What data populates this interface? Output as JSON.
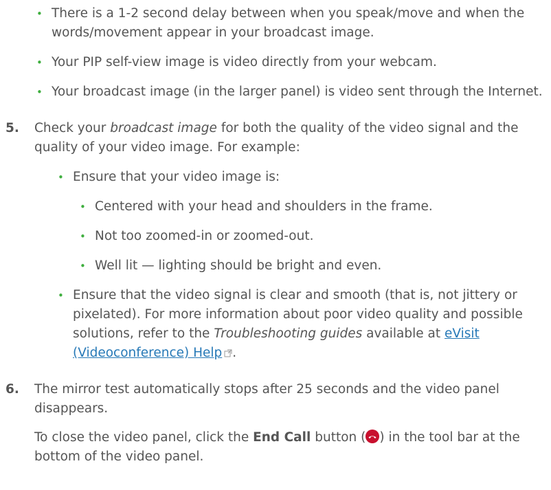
{
  "top_bullets": [
    "There is a 1-2 second delay between when you speak/move and when the words/movement appear in your broadcast image.",
    "Your PIP self-view image is video directly from your webcam.",
    "Your broadcast image (in the larger panel) is video sent through the Internet."
  ],
  "step5": {
    "number": "5.",
    "text_before": "Check your ",
    "text_emphasis": "broadcast image",
    "text_after": " for both the quality of the video signal and the quality of your video image. For example:",
    "bullet1": "Ensure that your video image is:",
    "sub_bullets": [
      "Centered with your head and shoulders in the frame.",
      "Not too zoomed-in or zoomed-out.",
      "Well lit — lighting should be bright and even."
    ],
    "bullet2_before": "Ensure that the video signal is clear and smooth (that is, not jittery or pixelated). For more information about poor video quality and possible solutions, refer to the ",
    "bullet2_emphasis": "Troubleshooting guides",
    "bullet2_middle": " available at ",
    "link_text": "eVisit (Videoconference) Help",
    "bullet2_end": "."
  },
  "step6": {
    "number": "6.",
    "text": "The mirror test automatically stops after 25 seconds and the video panel disappears.",
    "close_before": "To close the video panel, click the ",
    "close_bold": "End Call",
    "close_middle": " button (",
    "close_after": ") in the tool bar at the bottom of the video panel."
  },
  "colors": {
    "text": "#555555",
    "bullet": "#3eae3e",
    "link": "#2779b7",
    "end_call": "#c8102e"
  }
}
